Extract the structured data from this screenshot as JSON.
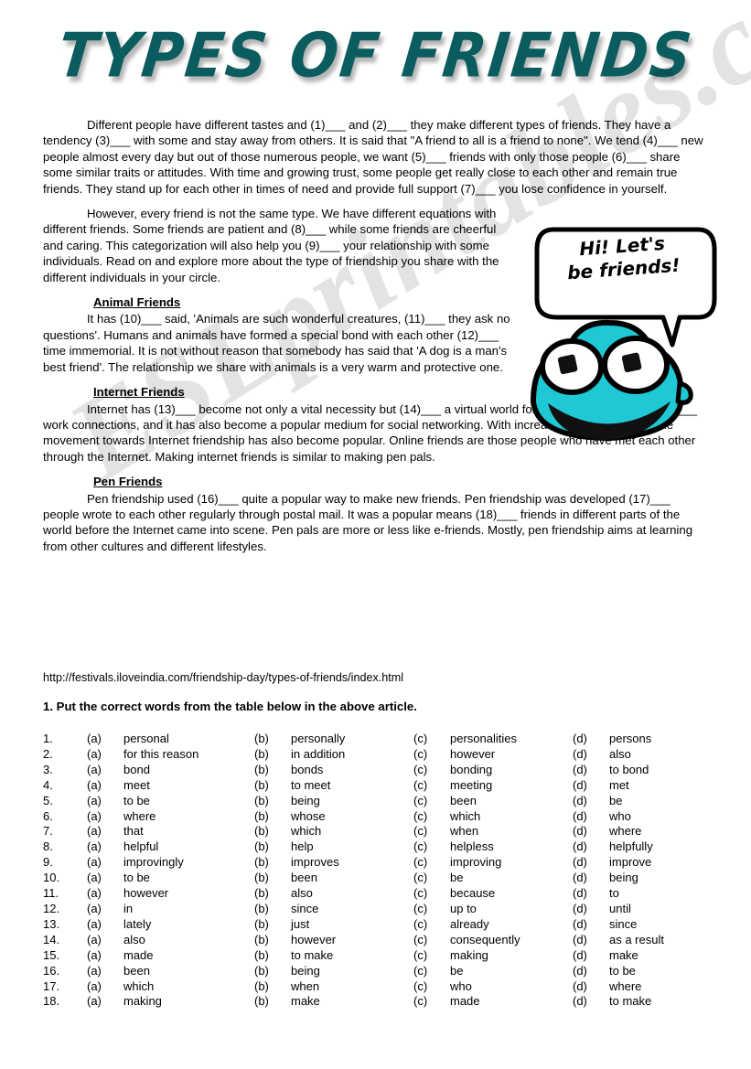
{
  "page": {
    "title": "TYPES OF FRIENDS",
    "watermark": "ESLprintables.com"
  },
  "article": {
    "p1": "Different people have different tastes and (1)___  and (2)___  they make different types of friends. They have a tendency (3)___   with some and stay away from others. It is said that \"A friend to all is a friend to none\". We tend (4)___   new people almost every day but out of those numerous people, we want (5)___    friends with only those people (6)___     share some similar traits or attitudes. With time and growing trust, some people get really close to each other and remain true friends. They stand up for each other in times of need and provide full support (7)___  you lose confidence in yourself.",
    "p2": "However, every friend is not the same type. We have different equations with different friends. Some friends are patient and (8)___ while some friends are cheerful and caring. This categorization will also help you (9)___    your relationship with some individuals. Read on and explore more about the type of friendship you share with the different individuals in your circle.",
    "sections": [
      {
        "heading": "Animal Friends",
        "body": "It has (10)___    said, 'Animals are such wonderful creatures, (11)___     they ask no questions'. Humans and animals have formed a special bond with each other (12)___   time immemorial. It is not without reason that somebody has said that 'A dog is a man's best friend'. The relationship we share with animals is a very warm and protective one."
      },
      {
        "heading": "Internet Friends",
        "body": "Internet has (13)___  become not only a vital necessity but (14)___  a virtual world for people. People use it (15)___  work connections, and it has also become a popular medium for social networking. With increasing Internet usage, the movement towards Internet friendship has also become popular. Online friends are those people who have met each other through the Internet. Making internet friends is similar to making pen pals."
      },
      {
        "heading": "Pen Friends",
        "body": "Pen friendship used (16)___  quite a popular way to make new friends. Pen friendship was developed (17)___   people wrote to each other regularly through postal mail. It was a popular means (18)___   friends in different parts of the world before the Internet came into scene. Pen pals are more or less like e-friends. Mostly, pen friendship aims at learning from other cultures and different lifestyles."
      }
    ],
    "source_url": "http://festivals.iloveindia.com/friendship-day/types-of-friends/index.html"
  },
  "task": {
    "instruction": "1.  Put the correct words from the table below in the above article."
  },
  "options_table": {
    "labels": [
      "(a)",
      "(b)",
      "(c)",
      "(d)"
    ],
    "rows": [
      {
        "num": "1.",
        "a": "personal",
        "b": "personally",
        "c": "personalities",
        "d": "persons"
      },
      {
        "num": "2.",
        "a": "for this reason",
        "b": "in addition",
        "c": "however",
        "d": "also"
      },
      {
        "num": "3.",
        "a": "bond",
        "b": "bonds",
        "c": "bonding",
        "d": "to bond"
      },
      {
        "num": "4.",
        "a": "meet",
        "b": "to meet",
        "c": "meeting",
        "d": "met"
      },
      {
        "num": "5.",
        "a": "to be",
        "b": "being",
        "c": "been",
        "d": "be"
      },
      {
        "num": "6.",
        "a": "where",
        "b": "whose",
        "c": "which",
        "d": "who"
      },
      {
        "num": "7.",
        "a": "that",
        "b": "which",
        "c": "when",
        "d": "where"
      },
      {
        "num": "8.",
        "a": "helpful",
        "b": "help",
        "c": "helpless",
        "d": "helpfully"
      },
      {
        "num": "9.",
        "a": "improvingly",
        "b": "improves",
        "c": "improving",
        "d": "improve"
      },
      {
        "num": "10.",
        "a": "to be",
        "b": "been",
        "c": "be",
        "d": "being"
      },
      {
        "num": "11.",
        "a": "however",
        "b": "also",
        "c": "because",
        "d": "to"
      },
      {
        "num": "12.",
        "a": "in",
        "b": "since",
        "c": "up to",
        "d": "until"
      },
      {
        "num": "13.",
        "a": "lately",
        "b": "just",
        "c": "already",
        "d": "since"
      },
      {
        "num": "14.",
        "a": "also",
        "b": "however",
        "c": "consequently",
        "d": "as a result"
      },
      {
        "num": "15.",
        "a": "made",
        "b": "to make",
        "c": "making",
        "d": "make"
      },
      {
        "num": "16.",
        "a": "been",
        "b": "being",
        "c": "be",
        "d": "to be"
      },
      {
        "num": "17.",
        "a": "which",
        "b": "when",
        "c": "who",
        "d": "where"
      },
      {
        "num": "18.",
        "a": "making",
        "b": "make",
        "c": "made",
        "d": "to make"
      }
    ]
  },
  "cartoon": {
    "speech_line1": "Hi! Let's",
    "speech_line2": "be friends!",
    "face_color": "#1ec8d4",
    "outline_color": "#000000"
  }
}
